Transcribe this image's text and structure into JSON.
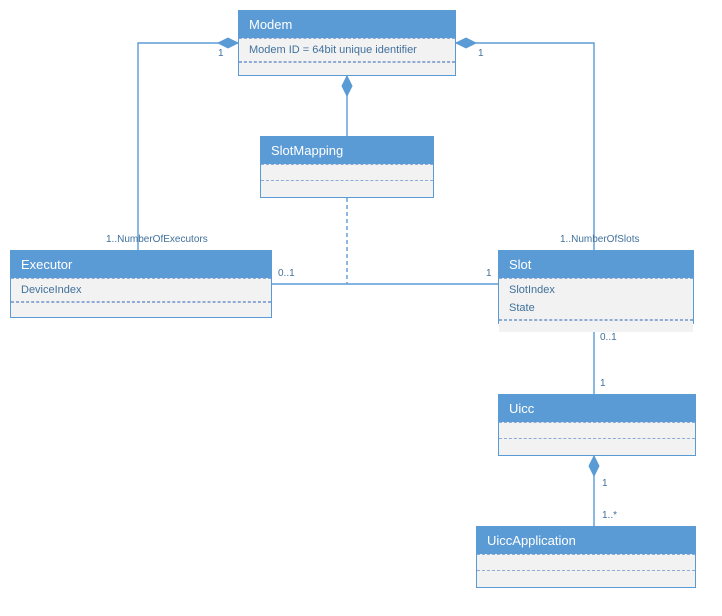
{
  "classes": {
    "modem": {
      "name": "Modem",
      "attr": "Modem ID = 64bit unique identifier"
    },
    "slotmapping": {
      "name": "SlotMapping"
    },
    "executor": {
      "name": "Executor",
      "attr": "DeviceIndex"
    },
    "slot": {
      "name": "Slot",
      "attr1": "SlotIndex",
      "attr2": "State"
    },
    "uicc": {
      "name": "Uicc"
    },
    "uiccapp": {
      "name": "UiccApplication"
    }
  },
  "multiplicities": {
    "modem_left_1": "1",
    "modem_right_1": "1",
    "exec_range": "1..NumberOfExecutors",
    "slot_range": "1..NumberOfSlots",
    "exec_slot_left": "0..1",
    "exec_slot_right": "1",
    "slot_uicc_top": "0..1",
    "slot_uicc_bottom": "1",
    "uicc_app_top": "1",
    "uicc_app_bottom": "1..*"
  }
}
